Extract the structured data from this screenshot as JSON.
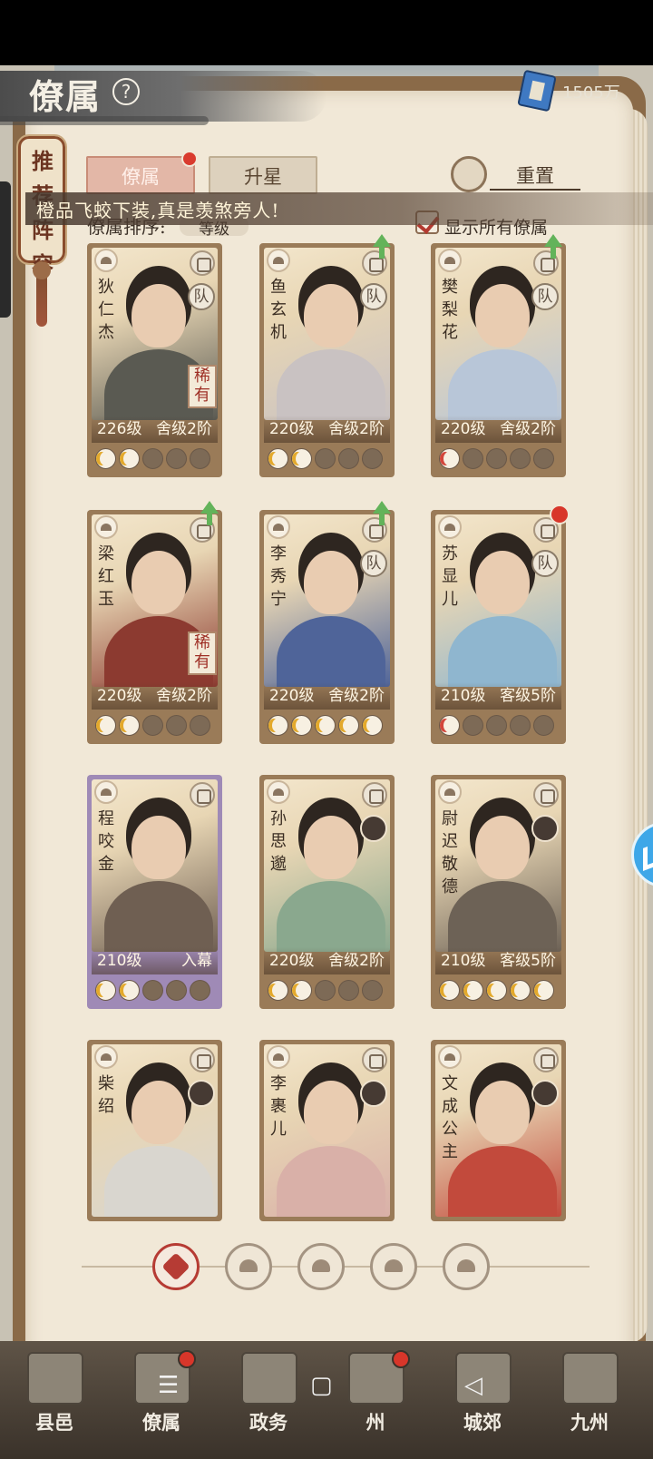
{
  "header": {
    "title": "僚属",
    "money": "1505万",
    "help_icon": "question-icon",
    "money_icon": "book-icon"
  },
  "recommend": {
    "label": "推荐阵容"
  },
  "tabs": [
    {
      "label": "僚属",
      "active": true
    },
    {
      "label": "升星",
      "active": false
    }
  ],
  "reset": {
    "label": "重置"
  },
  "notice": {
    "text": "橙品飞蛟下装,真是羡煞旁人!"
  },
  "sort": {
    "label": "僚属排序:",
    "value": "等级"
  },
  "show_all": {
    "label": "显示所有僚属",
    "checked": true
  },
  "team_badge": "队",
  "rare_badge": "稀有",
  "cards": [
    {
      "name": "狄仁杰",
      "level": "226级",
      "rank": "舍级2阶",
      "stars": [
        1,
        1,
        0,
        0,
        0
      ],
      "rare": true,
      "team": true,
      "up": false,
      "dot": false,
      "theme": "#5a5a52"
    },
    {
      "name": "鱼玄机",
      "level": "220级",
      "rank": "舍级2阶",
      "stars": [
        1,
        1,
        0,
        0,
        0
      ],
      "rare": false,
      "team": true,
      "up": true,
      "dot": false,
      "theme": "#c9c2c2"
    },
    {
      "name": "樊梨花",
      "level": "220级",
      "rank": "舍级2阶",
      "stars": [
        2,
        0,
        0,
        0,
        0
      ],
      "rare": false,
      "team": true,
      "up": true,
      "dot": false,
      "theme": "#b8c6d8"
    },
    {
      "name": "梁红玉",
      "level": "220级",
      "rank": "舍级2阶",
      "stars": [
        1,
        1,
        0,
        0,
        0
      ],
      "rare": true,
      "team": false,
      "up": true,
      "dot": false,
      "theme": "#8c3a30"
    },
    {
      "name": "李秀宁",
      "level": "220级",
      "rank": "舍级2阶",
      "stars": [
        1,
        1,
        1,
        1,
        1
      ],
      "rare": false,
      "team": true,
      "up": true,
      "dot": false,
      "theme": "#4f6499"
    },
    {
      "name": "苏显儿",
      "level": "210级",
      "rank": "客级5阶",
      "stars": [
        2,
        0,
        0,
        0,
        0
      ],
      "rare": false,
      "team": true,
      "up": false,
      "dot": true,
      "theme": "#8fb6cf"
    },
    {
      "name": "程咬金",
      "level": "210级",
      "rank": "入幕",
      "stars": [
        1,
        1,
        0,
        0,
        0
      ],
      "rare": false,
      "team": false,
      "up": false,
      "dot": false,
      "theme": "#6f5f52",
      "purple": true
    },
    {
      "name": "孙思邈",
      "level": "220级",
      "rank": "舍级2阶",
      "stars": [
        1,
        1,
        0,
        0,
        0
      ],
      "rare": false,
      "team": false,
      "up": false,
      "dot": false,
      "theme": "#8aa88e",
      "mini": true
    },
    {
      "name": "尉迟敬德",
      "level": "210级",
      "rank": "客级5阶",
      "stars": [
        1,
        1,
        1,
        1,
        1
      ],
      "rare": false,
      "team": false,
      "up": false,
      "dot": false,
      "theme": "#6d6256",
      "mini": true
    },
    {
      "name": "柴绍",
      "level": "",
      "rank": "",
      "stars": [],
      "rare": false,
      "team": false,
      "up": false,
      "dot": false,
      "theme": "#d9d6cf",
      "mini": true
    },
    {
      "name": "李裹儿",
      "level": "",
      "rank": "",
      "stars": [],
      "rare": false,
      "team": false,
      "up": false,
      "dot": false,
      "theme": "#d9b0a8",
      "mini": true
    },
    {
      "name": "文成公主",
      "level": "",
      "rank": "",
      "stars": [],
      "rare": false,
      "team": false,
      "up": false,
      "dot": false,
      "theme": "#c24a3c",
      "mini": true
    }
  ],
  "filters": [
    {
      "name": "all-filter-icon",
      "active": true
    },
    {
      "name": "bell-filter-icon"
    },
    {
      "name": "cat-filter-icon"
    },
    {
      "name": "fan-filter-icon"
    },
    {
      "name": "dog-filter-icon"
    }
  ],
  "nav": [
    {
      "label": "县邑",
      "dot": false
    },
    {
      "label": "僚属",
      "dot": true
    },
    {
      "label": "政务",
      "dot": false
    },
    {
      "label": "州",
      "dot": true
    },
    {
      "label": "城郊",
      "dot": false
    },
    {
      "label": "九州",
      "dot": false
    }
  ],
  "system_nav": {
    "menu": "☰",
    "home": "▢",
    "back": "◁"
  }
}
